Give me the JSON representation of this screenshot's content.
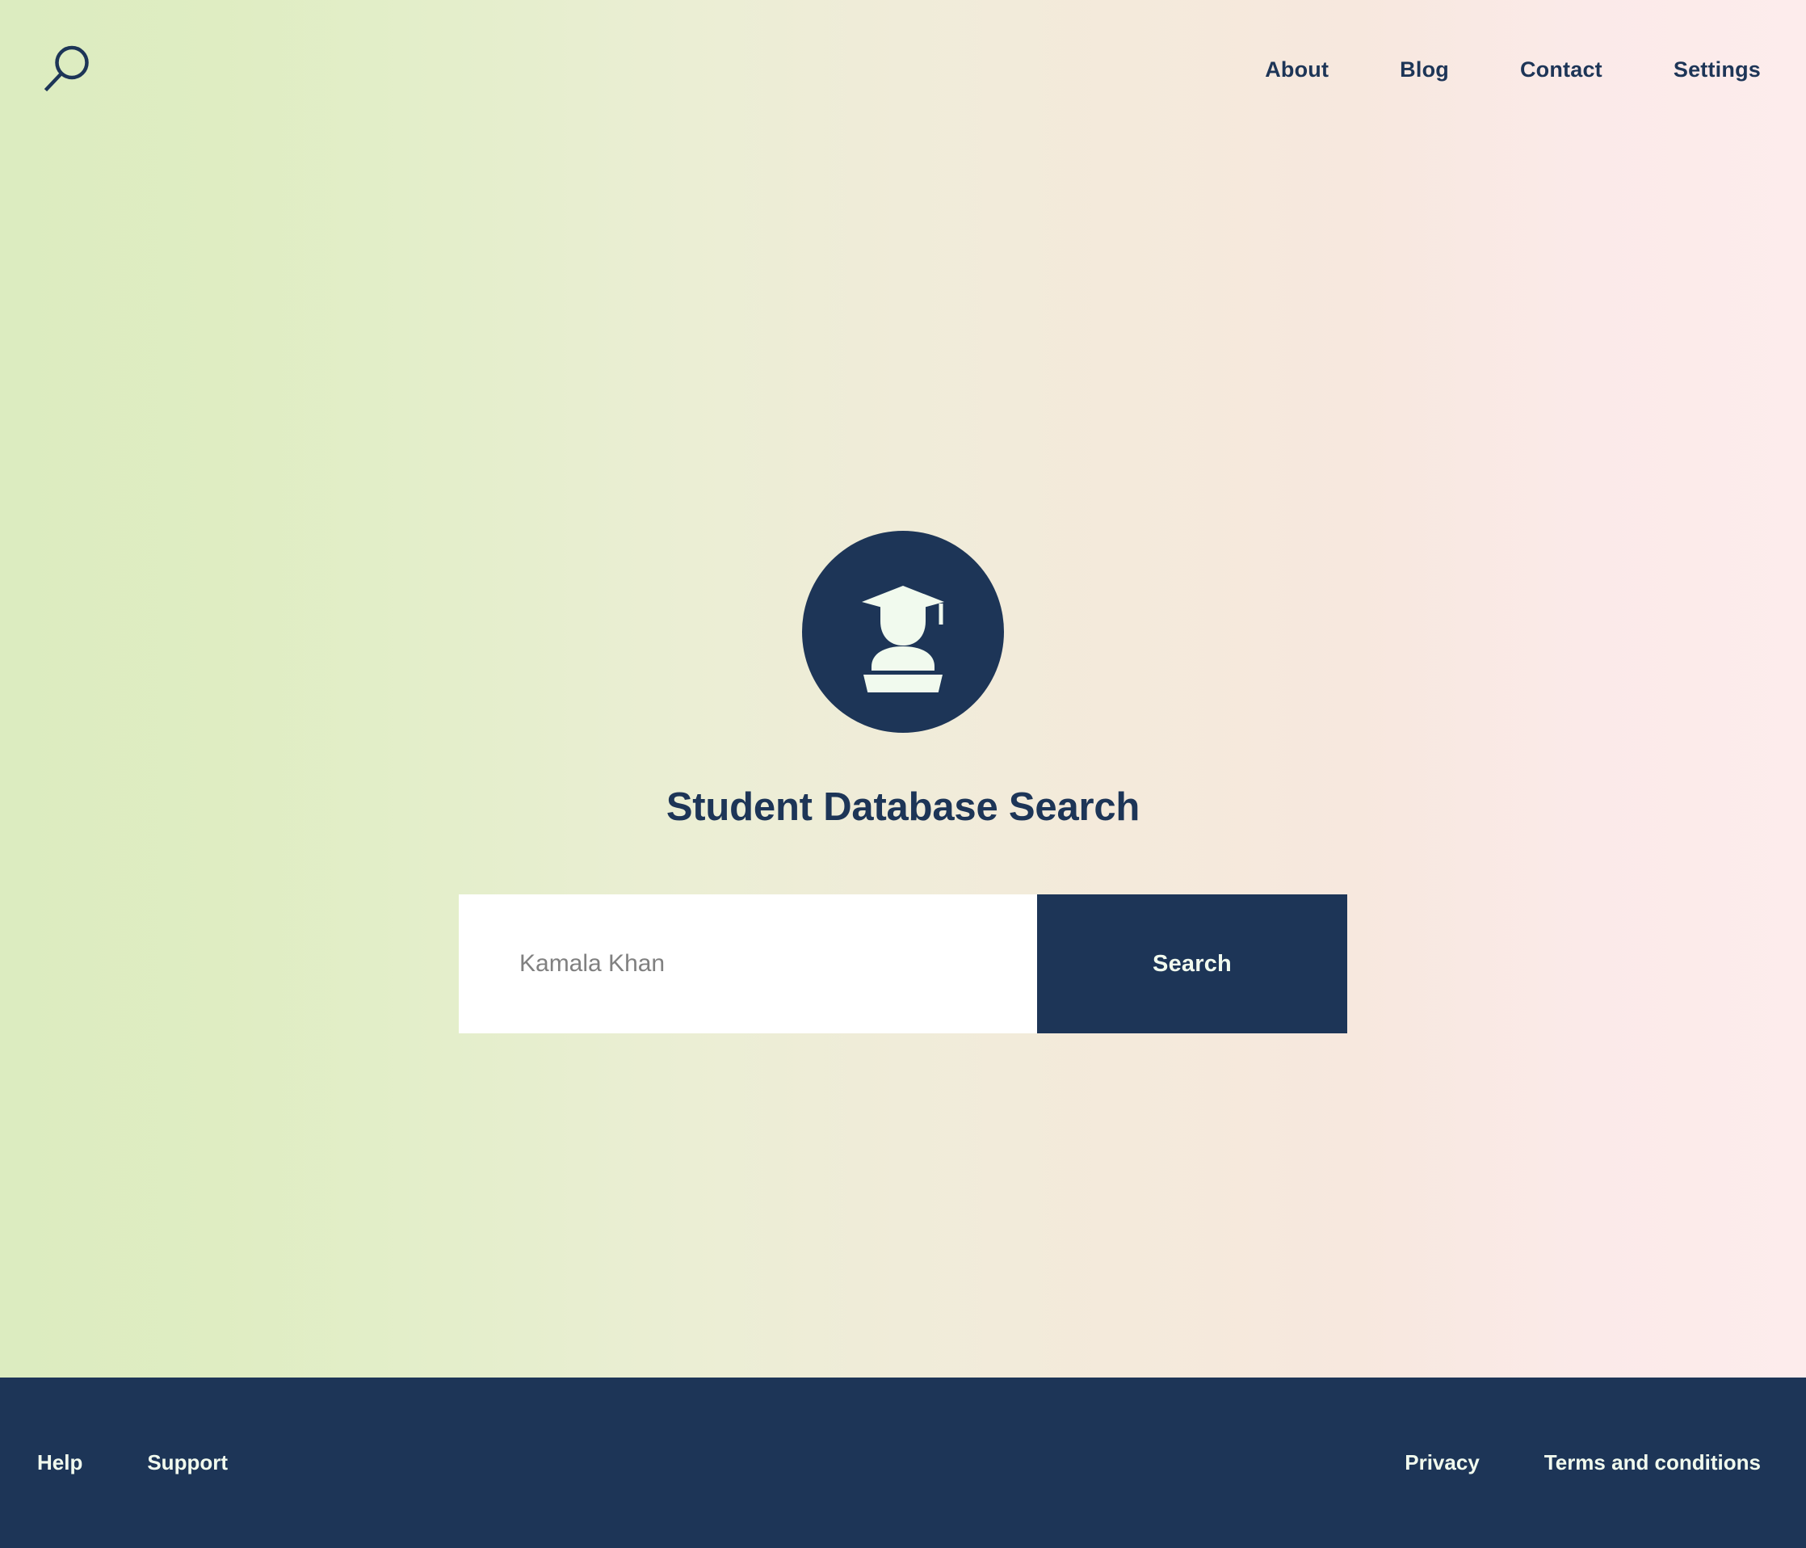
{
  "header": {
    "search_icon": "magnifier-icon",
    "nav": [
      {
        "label": "About"
      },
      {
        "label": "Blog"
      },
      {
        "label": "Contact"
      },
      {
        "label": "Settings"
      }
    ]
  },
  "hero": {
    "logo_icon": "graduate-student-icon",
    "title": "Student Database Search",
    "search": {
      "placeholder": "Kamala Khan",
      "value": "",
      "button_label": "Search"
    }
  },
  "footer": {
    "left_links": [
      {
        "label": "Help"
      },
      {
        "label": "Support"
      }
    ],
    "right_links": [
      {
        "label": "Privacy"
      },
      {
        "label": "Terms and conditions"
      }
    ]
  },
  "colors": {
    "navy": "#1d3557",
    "cream": "#f1faee",
    "gradient_start": "#dcecc0",
    "gradient_mid": "#f0ecd9",
    "gradient_end": "#fdecec",
    "placeholder_gray": "#808080"
  }
}
